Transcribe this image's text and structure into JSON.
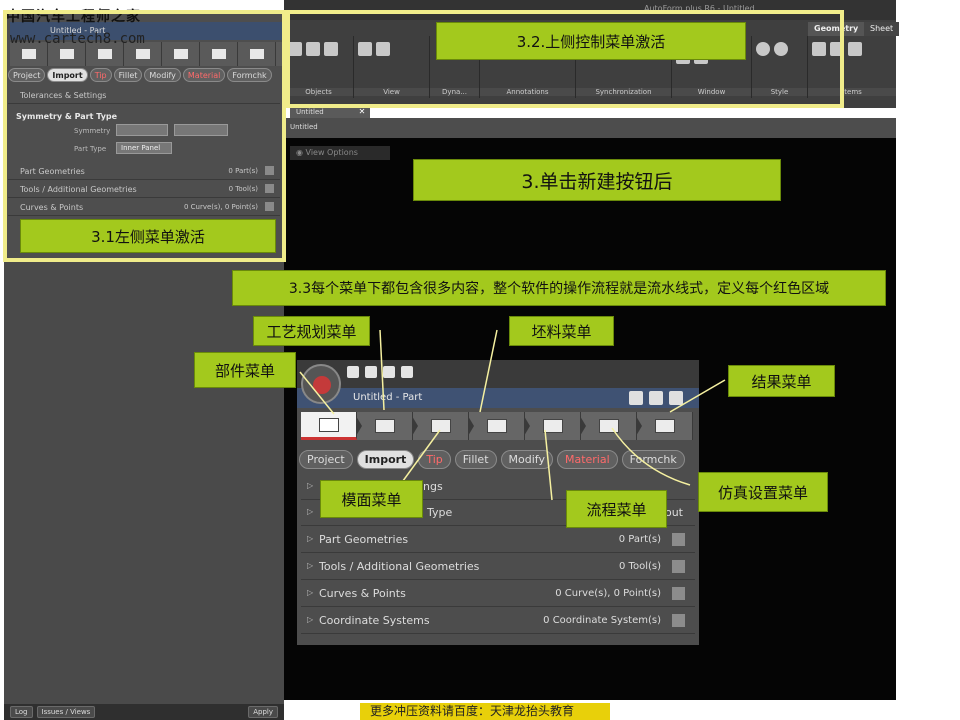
{
  "watermark": {
    "text": "中国汽车工程师之家",
    "url": "www.cartech8.com"
  },
  "left_panel": {
    "title": "Untitled - Part",
    "tabs": [
      "Project",
      "Import",
      "Tip",
      "Fillet",
      "Modify",
      "Material",
      "Formchk"
    ],
    "rows": {
      "tolerances": "Tolerances & Settings",
      "symmetry_title": "Symmetry & Part Type",
      "symmetry_label": "Symmetry",
      "part_type_label": "Part Type",
      "part_type_value": "Inner Panel",
      "part_geometries": "Part Geometries",
      "part_geometries_count": "0 Part(s)",
      "tools": "Tools / Additional Geometries",
      "tools_count": "0 Tool(s)",
      "curves": "Curves & Points",
      "curves_count": "0 Curve(s), 0 Point(s)"
    },
    "bottom": {
      "log": "Log",
      "issues": "Issues / Views",
      "apply": "Apply"
    }
  },
  "ribbon": {
    "app_title": "AutoForm plus R6 - Untitled",
    "tab_geometry": "Geometry",
    "tab_sheet": "Sheet",
    "groups": [
      "Objects",
      "View",
      "Dyna...",
      "Annotations",
      "Synchronization",
      "Window",
      "Style",
      "Items"
    ]
  },
  "document": {
    "tab": "Untitled",
    "bar": "Untitled",
    "view_options": "View Options"
  },
  "zoom_panel": {
    "title": "Untitled - Part",
    "tabs": [
      "Project",
      "Import",
      "Tip",
      "Fillet",
      "Modify",
      "Material",
      "Formchk"
    ],
    "rows": {
      "tolerances_tail": "ngs",
      "symmetry_tail": "Type",
      "symmetry_right": "out",
      "part_geometries": "Part Geometries",
      "part_geometries_count": "0 Part(s)",
      "tools": "Tools / Additional Geometries",
      "tools_count": "0 Tool(s)",
      "curves": "Curves & Points",
      "curves_count": "0 Curve(s), 0 Point(s)",
      "coords": "Coordinate Systems",
      "coords_count": "0 Coordinate System(s)"
    }
  },
  "callouts": {
    "top_menu": "3.2.上侧控制菜单激活",
    "new_button": "3.单击新建按钮后",
    "left_menu": "3.1左侧菜单激活",
    "description": "3.3每个菜单下都包含很多内容，整个软件的操作流程就是流水线式，定义每个红色区域",
    "process_plan": "工艺规划菜单",
    "blank_menu": "坯料菜单",
    "part_menu": "部件菜单",
    "result_menu": "结果菜单",
    "die_face_menu": "模面菜单",
    "sim_setup_menu": "仿真设置菜单",
    "process_menu": "流程菜单"
  },
  "footer_note": "更多冲压资料请百度：天津龙抬头教育",
  "colors": {
    "callout_green": "#a3c91d",
    "frame_yellow": "#f0ec8a",
    "note_yellow": "#e8d00a",
    "active_red": "#cc3333"
  }
}
